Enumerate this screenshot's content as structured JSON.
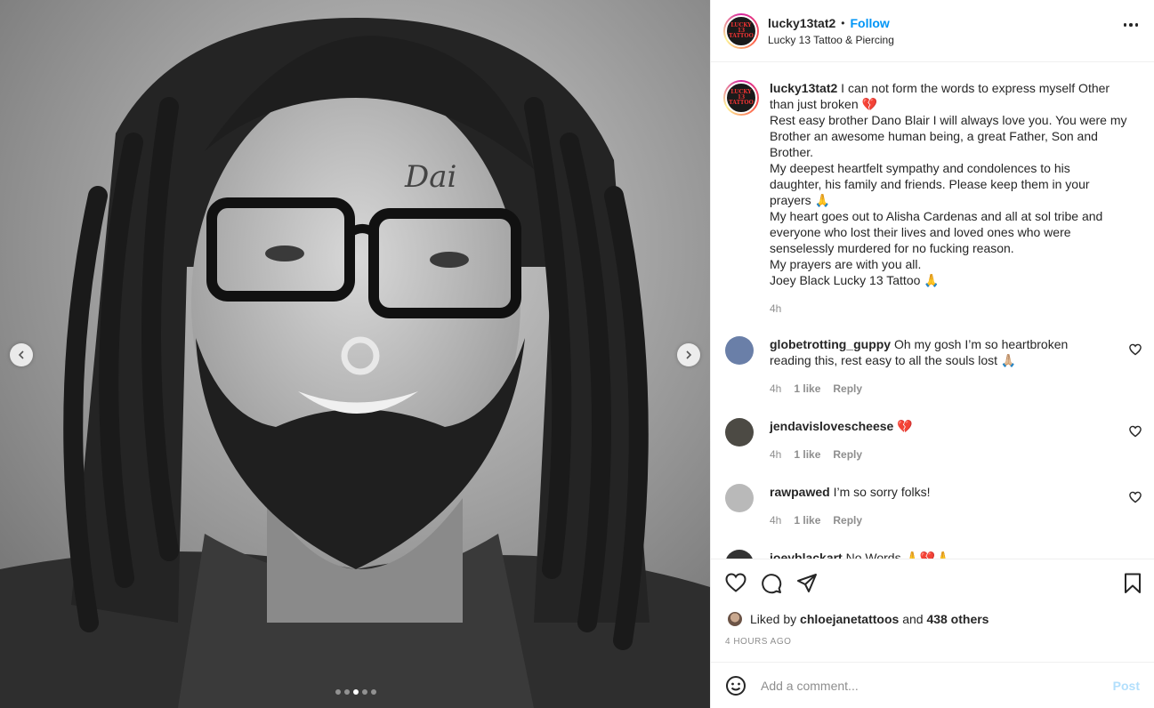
{
  "post": {
    "username": "lucky13tat2",
    "separator": "•",
    "follow_label": "Follow",
    "location": "Lucky 13 Tattoo & Piercing",
    "logo_lines": [
      "LUCKY",
      "13",
      "TATTOO"
    ],
    "caption_lines": [
      "I can not form the words to express myself Other",
      "than just broken 💔",
      "Rest easy brother Dano Blair I will always love you. You were my",
      "Brother an awesome human being, a great Father, Son and",
      "Brother.",
      "My deepest heartfelt sympathy and condolences to his",
      "daughter, his family and friends. Please keep them in your",
      "prayers 🙏",
      "My heart goes out to Alisha Cardenas and all at sol tribe and",
      "everyone who lost their lives and loved ones who were",
      "senselessly murdered for no fucking reason.",
      "My prayers are with you all.",
      "Joey Black Lucky 13 Tattoo 🙏"
    ],
    "caption_time": "4h"
  },
  "comments": [
    {
      "username": "globetrotting_guppy",
      "text_lines": [
        "Oh my gosh I’m so heartbroken",
        "reading this, rest easy to all the souls lost 🙏🏼"
      ],
      "time": "4h",
      "likes": "1 like",
      "reply": "Reply",
      "avatar_color": "#6a7fa8"
    },
    {
      "username": "jendavislovescheese",
      "text_lines": [
        "💔"
      ],
      "time": "4h",
      "likes": "1 like",
      "reply": "Reply",
      "avatar_color": "#4c4a44"
    },
    {
      "username": "rawpawed",
      "text_lines": [
        "I’m so sorry folks!"
      ],
      "time": "4h",
      "likes": "1 like",
      "reply": "Reply",
      "avatar_color": "#b9b9b9"
    },
    {
      "username": "joeyblackart",
      "text_lines": [
        "No Words 🙏💔🙏"
      ],
      "time": "",
      "likes": "",
      "reply": "",
      "avatar_color": "#333333"
    }
  ],
  "engagement": {
    "liked_by_prefix": "Liked by",
    "liked_by_user": "chloejanetattoos",
    "and_text": "and",
    "others": "438 others",
    "time_ago": "4 HOURS AGO"
  },
  "composer": {
    "placeholder": "Add a comment...",
    "post_label": "Post"
  },
  "carousel": {
    "slide_count": 5,
    "active_index": 2
  },
  "colors": {
    "accent": "#0095f6",
    "muted": "#8e8e8e",
    "post_disabled": "#b2dffc"
  }
}
